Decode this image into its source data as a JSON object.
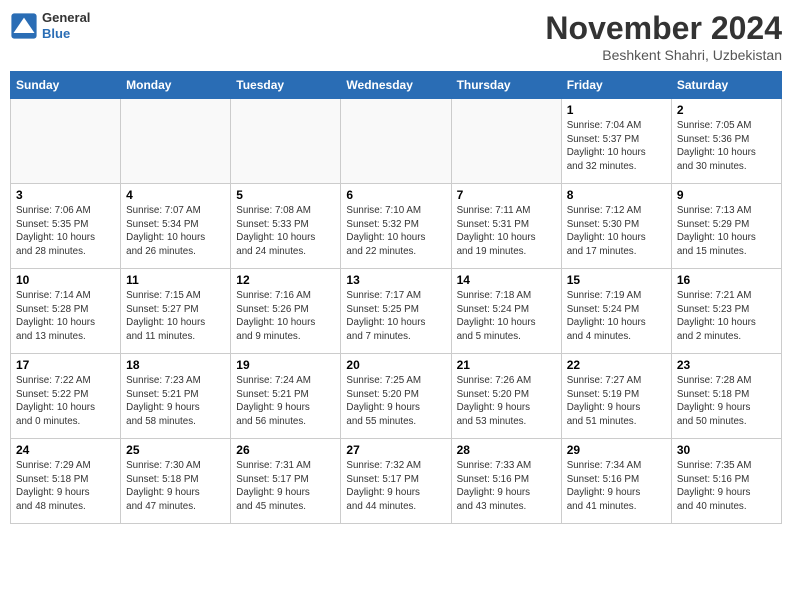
{
  "header": {
    "logo_general": "General",
    "logo_blue": "Blue",
    "month_title": "November 2024",
    "location": "Beshkent Shahri, Uzbekistan"
  },
  "weekdays": [
    "Sunday",
    "Monday",
    "Tuesday",
    "Wednesday",
    "Thursday",
    "Friday",
    "Saturday"
  ],
  "weeks": [
    [
      {
        "day": "",
        "info": ""
      },
      {
        "day": "",
        "info": ""
      },
      {
        "day": "",
        "info": ""
      },
      {
        "day": "",
        "info": ""
      },
      {
        "day": "",
        "info": ""
      },
      {
        "day": "1",
        "info": "Sunrise: 7:04 AM\nSunset: 5:37 PM\nDaylight: 10 hours\nand 32 minutes."
      },
      {
        "day": "2",
        "info": "Sunrise: 7:05 AM\nSunset: 5:36 PM\nDaylight: 10 hours\nand 30 minutes."
      }
    ],
    [
      {
        "day": "3",
        "info": "Sunrise: 7:06 AM\nSunset: 5:35 PM\nDaylight: 10 hours\nand 28 minutes."
      },
      {
        "day": "4",
        "info": "Sunrise: 7:07 AM\nSunset: 5:34 PM\nDaylight: 10 hours\nand 26 minutes."
      },
      {
        "day": "5",
        "info": "Sunrise: 7:08 AM\nSunset: 5:33 PM\nDaylight: 10 hours\nand 24 minutes."
      },
      {
        "day": "6",
        "info": "Sunrise: 7:10 AM\nSunset: 5:32 PM\nDaylight: 10 hours\nand 22 minutes."
      },
      {
        "day": "7",
        "info": "Sunrise: 7:11 AM\nSunset: 5:31 PM\nDaylight: 10 hours\nand 19 minutes."
      },
      {
        "day": "8",
        "info": "Sunrise: 7:12 AM\nSunset: 5:30 PM\nDaylight: 10 hours\nand 17 minutes."
      },
      {
        "day": "9",
        "info": "Sunrise: 7:13 AM\nSunset: 5:29 PM\nDaylight: 10 hours\nand 15 minutes."
      }
    ],
    [
      {
        "day": "10",
        "info": "Sunrise: 7:14 AM\nSunset: 5:28 PM\nDaylight: 10 hours\nand 13 minutes."
      },
      {
        "day": "11",
        "info": "Sunrise: 7:15 AM\nSunset: 5:27 PM\nDaylight: 10 hours\nand 11 minutes."
      },
      {
        "day": "12",
        "info": "Sunrise: 7:16 AM\nSunset: 5:26 PM\nDaylight: 10 hours\nand 9 minutes."
      },
      {
        "day": "13",
        "info": "Sunrise: 7:17 AM\nSunset: 5:25 PM\nDaylight: 10 hours\nand 7 minutes."
      },
      {
        "day": "14",
        "info": "Sunrise: 7:18 AM\nSunset: 5:24 PM\nDaylight: 10 hours\nand 5 minutes."
      },
      {
        "day": "15",
        "info": "Sunrise: 7:19 AM\nSunset: 5:24 PM\nDaylight: 10 hours\nand 4 minutes."
      },
      {
        "day": "16",
        "info": "Sunrise: 7:21 AM\nSunset: 5:23 PM\nDaylight: 10 hours\nand 2 minutes."
      }
    ],
    [
      {
        "day": "17",
        "info": "Sunrise: 7:22 AM\nSunset: 5:22 PM\nDaylight: 10 hours\nand 0 minutes."
      },
      {
        "day": "18",
        "info": "Sunrise: 7:23 AM\nSunset: 5:21 PM\nDaylight: 9 hours\nand 58 minutes."
      },
      {
        "day": "19",
        "info": "Sunrise: 7:24 AM\nSunset: 5:21 PM\nDaylight: 9 hours\nand 56 minutes."
      },
      {
        "day": "20",
        "info": "Sunrise: 7:25 AM\nSunset: 5:20 PM\nDaylight: 9 hours\nand 55 minutes."
      },
      {
        "day": "21",
        "info": "Sunrise: 7:26 AM\nSunset: 5:20 PM\nDaylight: 9 hours\nand 53 minutes."
      },
      {
        "day": "22",
        "info": "Sunrise: 7:27 AM\nSunset: 5:19 PM\nDaylight: 9 hours\nand 51 minutes."
      },
      {
        "day": "23",
        "info": "Sunrise: 7:28 AM\nSunset: 5:18 PM\nDaylight: 9 hours\nand 50 minutes."
      }
    ],
    [
      {
        "day": "24",
        "info": "Sunrise: 7:29 AM\nSunset: 5:18 PM\nDaylight: 9 hours\nand 48 minutes."
      },
      {
        "day": "25",
        "info": "Sunrise: 7:30 AM\nSunset: 5:18 PM\nDaylight: 9 hours\nand 47 minutes."
      },
      {
        "day": "26",
        "info": "Sunrise: 7:31 AM\nSunset: 5:17 PM\nDaylight: 9 hours\nand 45 minutes."
      },
      {
        "day": "27",
        "info": "Sunrise: 7:32 AM\nSunset: 5:17 PM\nDaylight: 9 hours\nand 44 minutes."
      },
      {
        "day": "28",
        "info": "Sunrise: 7:33 AM\nSunset: 5:16 PM\nDaylight: 9 hours\nand 43 minutes."
      },
      {
        "day": "29",
        "info": "Sunrise: 7:34 AM\nSunset: 5:16 PM\nDaylight: 9 hours\nand 41 minutes."
      },
      {
        "day": "30",
        "info": "Sunrise: 7:35 AM\nSunset: 5:16 PM\nDaylight: 9 hours\nand 40 minutes."
      }
    ]
  ]
}
